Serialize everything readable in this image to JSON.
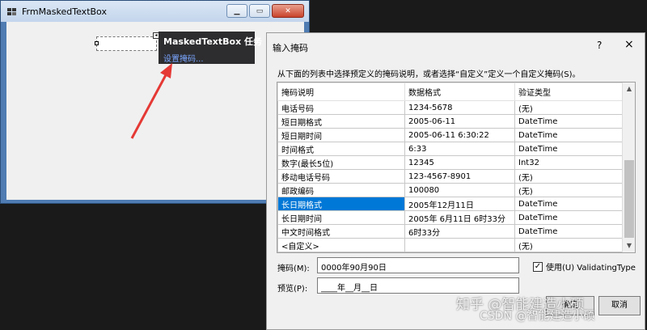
{
  "designer": {
    "title": "FrmMaskedTextBox",
    "tasks_title": "MaskedTextBox 任务",
    "tasks_link": "设置掩码..."
  },
  "dialog": {
    "title": "输入掩码",
    "help": "?",
    "close": "×",
    "description": "从下面的列表中选择预定义的掩码说明，或者选择“自定义”定义一个自定义掩码(S)。",
    "columns": [
      "掩码说明",
      "数据格式",
      "验证类型"
    ],
    "rows": [
      [
        "电话号码",
        "1234-5678",
        "(无)"
      ],
      [
        "短日期格式",
        "2005-06-11",
        "DateTime"
      ],
      [
        "短日期时间",
        "2005-06-11  6:30:22",
        "DateTime"
      ],
      [
        "时间格式",
        " 6:33",
        "DateTime"
      ],
      [
        "数字(最长5位)",
        "12345",
        "Int32"
      ],
      [
        "移动电话号码",
        "123-4567-8901",
        "(无)"
      ],
      [
        "邮政编码",
        "100080",
        "(无)"
      ],
      [
        "长日期格式",
        "2005年12月11日",
        "DateTime"
      ],
      [
        "长日期时间",
        "2005年 6月11日  6时33分",
        "DateTime"
      ],
      [
        "中文时间格式",
        " 6时33分",
        "DateTime"
      ],
      [
        "<自定义>",
        "",
        "(无)"
      ]
    ],
    "selected_row": 7,
    "mask_label": "掩码(M):",
    "mask_value": "0000年90月90日",
    "validating_label": "使用(U) ValidatingType",
    "validating_checked": "✓",
    "preview_label": "预览(P):",
    "preview_value": "____年__月__日",
    "ok_label": "确定",
    "cancel_label": "取消"
  },
  "watermark": {
    "line1": "知乎 @智能建造小硕",
    "line2": "CSDN @智能建造小硕"
  },
  "colors": {
    "selection": "#0078d7",
    "arrow": "#e53935",
    "tasks_bg": "#2d2d30"
  }
}
